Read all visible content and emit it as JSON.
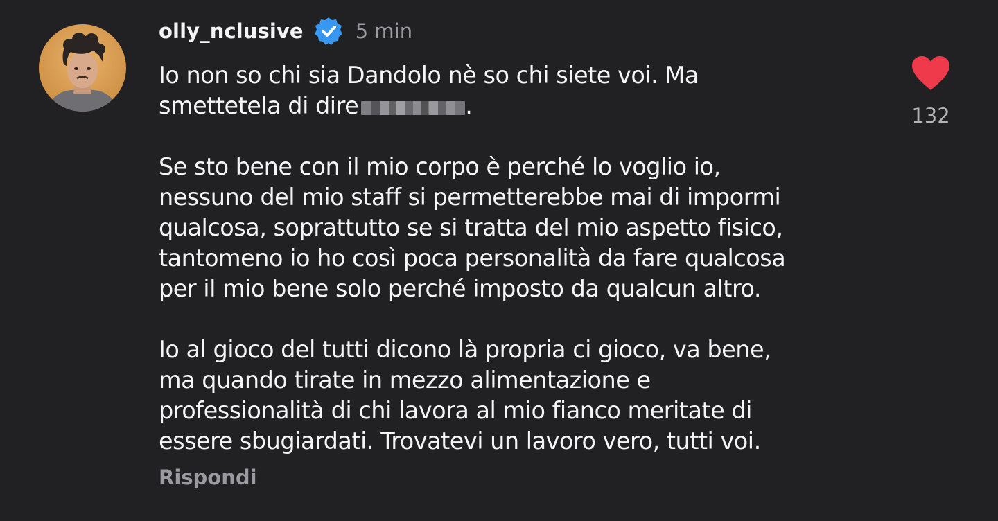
{
  "comment": {
    "username": "olly_nclusive",
    "verified": true,
    "time": "5 min",
    "body": {
      "p1": {
        "line1": "Io non so chi sia Dandolo nè so chi siete voi. Ma",
        "line2": "smettetela di dire",
        "line2_end": "."
      },
      "p2": {
        "line1": "Se sto bene con il mio corpo è perché lo voglio io,",
        "line2": "nessuno del mio staff si permetterebbe mai di impormi",
        "line3": "qualcosa, soprattutto se si tratta del mio aspetto fisico,",
        "line4": "tantomeno io ho così poca personalità da fare qualcosa",
        "line5": "per il mio bene solo perché imposto da qualcun altro."
      },
      "p3": {
        "line1": "Io al gioco del tutti dicono là propria ci gioco, va bene,",
        "line2": "ma quando tirate in mezzo alimentazione e",
        "line3": "professionalità di chi lavora al mio fianco meritate di",
        "line4": "essere sbugiardati. Trovatevi un lavoro vero, tutti voi."
      }
    },
    "reply_label": "Rispondi",
    "like_count": "132",
    "like_icon": "heart-icon",
    "colors": {
      "background": "#212124",
      "heart": "#ee3a4a",
      "verified_badge": "#3897f0",
      "muted_text": "#9a9aa0"
    }
  }
}
